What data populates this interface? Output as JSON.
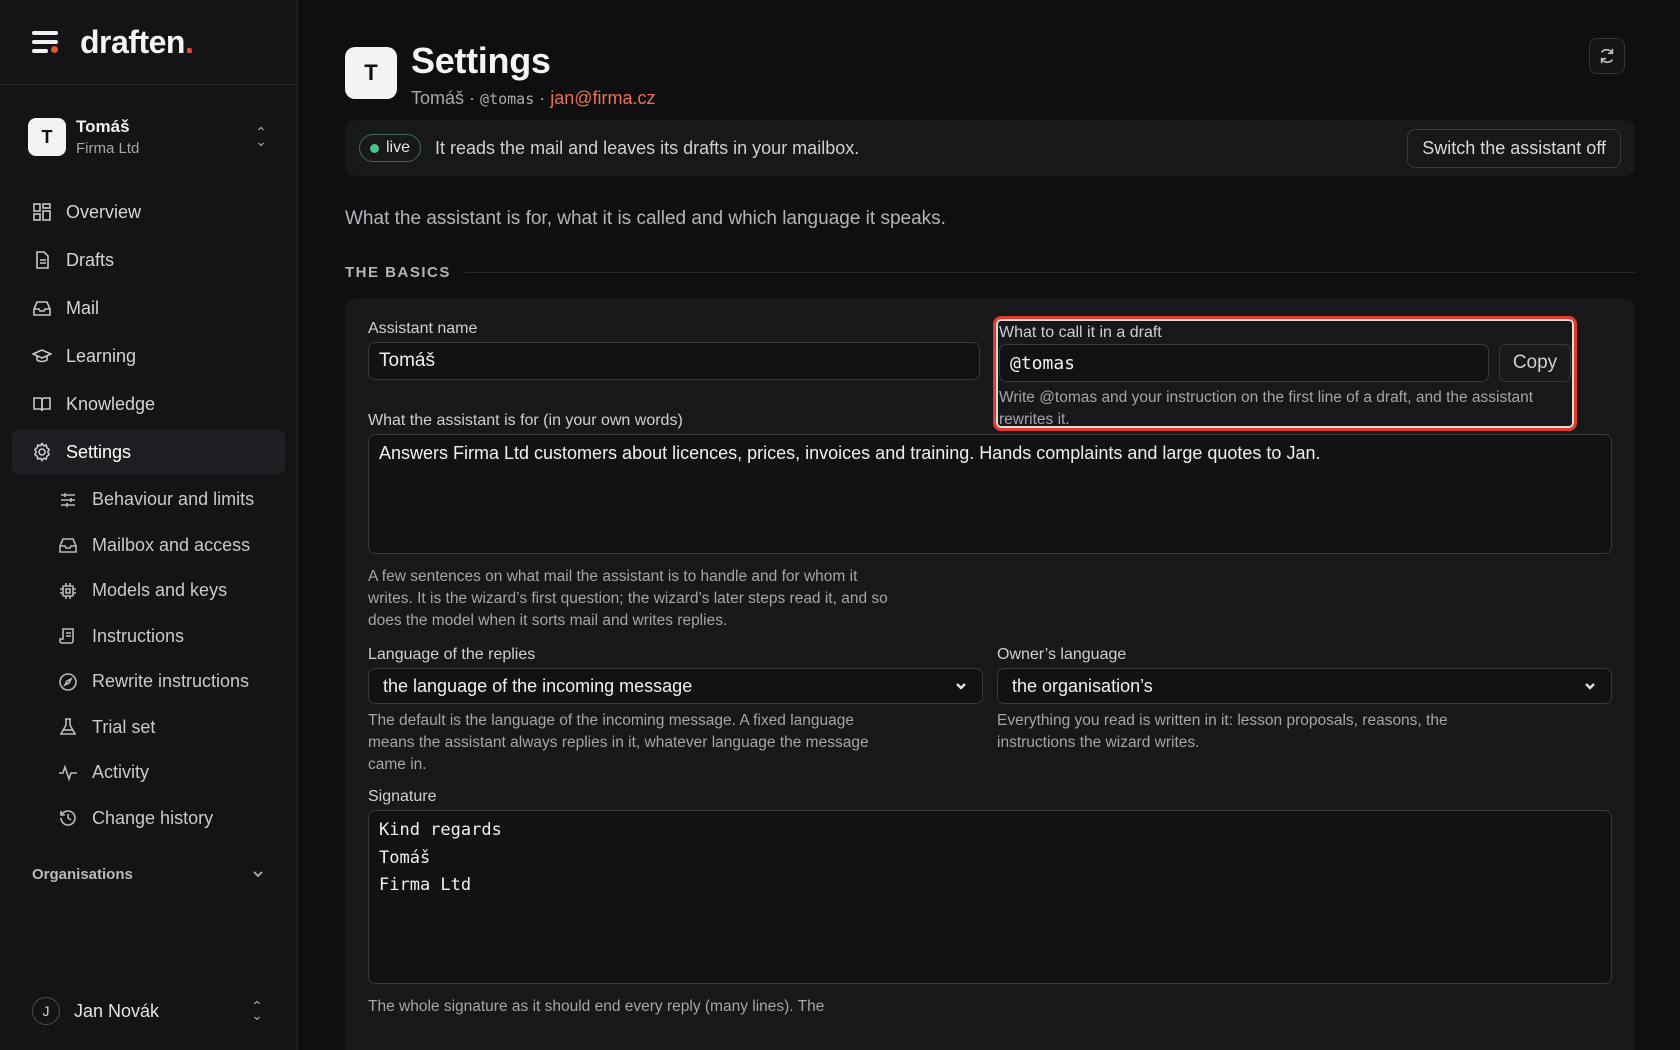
{
  "brand": {
    "name": "draften",
    "accent": "."
  },
  "account": {
    "initial": "T",
    "name": "Tomáš",
    "org": "Firma Ltd"
  },
  "nav": [
    {
      "label": "Overview",
      "icon": "grid-icon"
    },
    {
      "label": "Drafts",
      "icon": "document-icon"
    },
    {
      "label": "Mail",
      "icon": "inbox-icon"
    },
    {
      "label": "Learning",
      "icon": "graduation-cap-icon"
    },
    {
      "label": "Knowledge",
      "icon": "book-icon"
    },
    {
      "label": "Settings",
      "icon": "gear-icon",
      "active": true
    }
  ],
  "subnav": [
    {
      "label": "Behaviour and limits",
      "icon": "sliders-icon"
    },
    {
      "label": "Mailbox and access",
      "icon": "inbox-icon"
    },
    {
      "label": "Models and keys",
      "icon": "chip-icon"
    },
    {
      "label": "Instructions",
      "icon": "scroll-icon"
    },
    {
      "label": "Rewrite instructions",
      "icon": "compass-icon"
    },
    {
      "label": "Trial set",
      "icon": "flask-icon"
    },
    {
      "label": "Activity",
      "icon": "pulse-icon"
    },
    {
      "label": "Change history",
      "icon": "history-icon"
    }
  ],
  "organisations_label": "Organisations",
  "user": {
    "initial": "J",
    "name": "Jan Novák"
  },
  "header": {
    "initial": "T",
    "title": "Settings",
    "sub_name": "Tomáš",
    "sep": "·",
    "handle": "@tomas",
    "email": "jan@firma.cz"
  },
  "status": {
    "badge": "live",
    "text": "It reads the mail and leaves its drafts in your mailbox.",
    "button": "Switch the assistant off"
  },
  "intro": "What the assistant is for, what it is called and which language it speaks.",
  "section_title": "THE BASICS",
  "fields": {
    "assistant_name_label": "Assistant name",
    "assistant_name_value": "Tomáš",
    "call_label": "What to call it in a draft",
    "call_value": "@tomas",
    "copy_label": "Copy",
    "call_help": "Write @tomas and your instruction on the first line of a draft, and the assistant rewrites it.",
    "purpose_label": "What the assistant is for (in your own words)",
    "purpose_value": "Answers Firma Ltd customers about licences, prices, invoices and training. Hands complaints and large quotes to Jan.",
    "purpose_help": "A few sentences on what mail the assistant is to handle and for whom it writes. It is the wizard’s first question; the wizard’s later steps read it, and so does the model when it sorts mail and writes replies.",
    "reply_lang_label": "Language of the replies",
    "reply_lang_value": "the language of the incoming message",
    "reply_lang_help": "The default is the language of the incoming message. A fixed language means the assistant always replies in it, whatever language the message came in.",
    "owner_lang_label": "Owner’s language",
    "owner_lang_value": "the organisation’s",
    "owner_lang_help": "Everything you read is written in it: lesson proposals, reasons, the instructions the wizard writes.",
    "signature_label": "Signature",
    "signature_lines": [
      "Kind regards",
      "Tomáš",
      "Firma Ltd"
    ],
    "signature_help": "The whole signature as it should end every reply (many lines). The"
  },
  "colors": {
    "accent": "#e5533d",
    "live": "#4cc38a",
    "highlight": "#e23b2a"
  }
}
